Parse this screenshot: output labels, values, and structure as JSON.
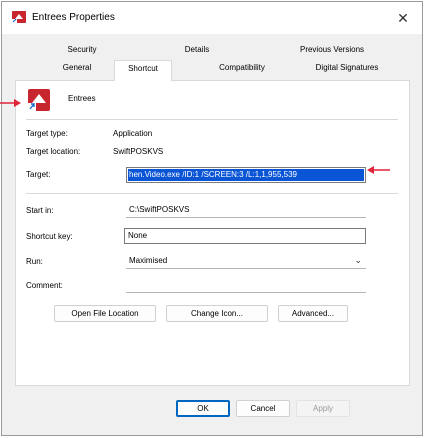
{
  "window": {
    "title": "Entrees Properties",
    "close_glyph": "✕"
  },
  "tabs": {
    "row1": [
      "Security",
      "Details",
      "Previous Versions"
    ],
    "row2": [
      "General",
      "Shortcut",
      "Compatibility",
      "Digital Signatures"
    ],
    "active": "Shortcut"
  },
  "shortcut": {
    "name": "Entrees",
    "target_type_label": "Target type:",
    "target_type_value": "Application",
    "target_location_label": "Target location:",
    "target_location_value": "SwiftPOSKVS",
    "target_label": "Target:",
    "target_value": "hen.Video.exe /ID:1 /SCREEN:3 /L:1,1,955,539",
    "start_in_label": "Start in:",
    "start_in_value": "C:\\SwiftPOSKVS",
    "shortcut_key_label": "Shortcut key:",
    "shortcut_key_value": "None",
    "run_label": "Run:",
    "run_value": "Maximised",
    "comment_label": "Comment:",
    "comment_value": ""
  },
  "buttons": {
    "open_file_location": "Open File Location",
    "change_icon": "Change Icon...",
    "advanced": "Advanced...",
    "ok": "OK",
    "cancel": "Cancel",
    "apply": "Apply"
  },
  "colors": {
    "annotation_arrow": "#e0243a",
    "selection": "#0a54d6",
    "app_icon": "#c8262e"
  },
  "icons": {
    "title": "app-shortcut-icon",
    "close": "close-icon",
    "chevron": "chevron-down-icon"
  }
}
